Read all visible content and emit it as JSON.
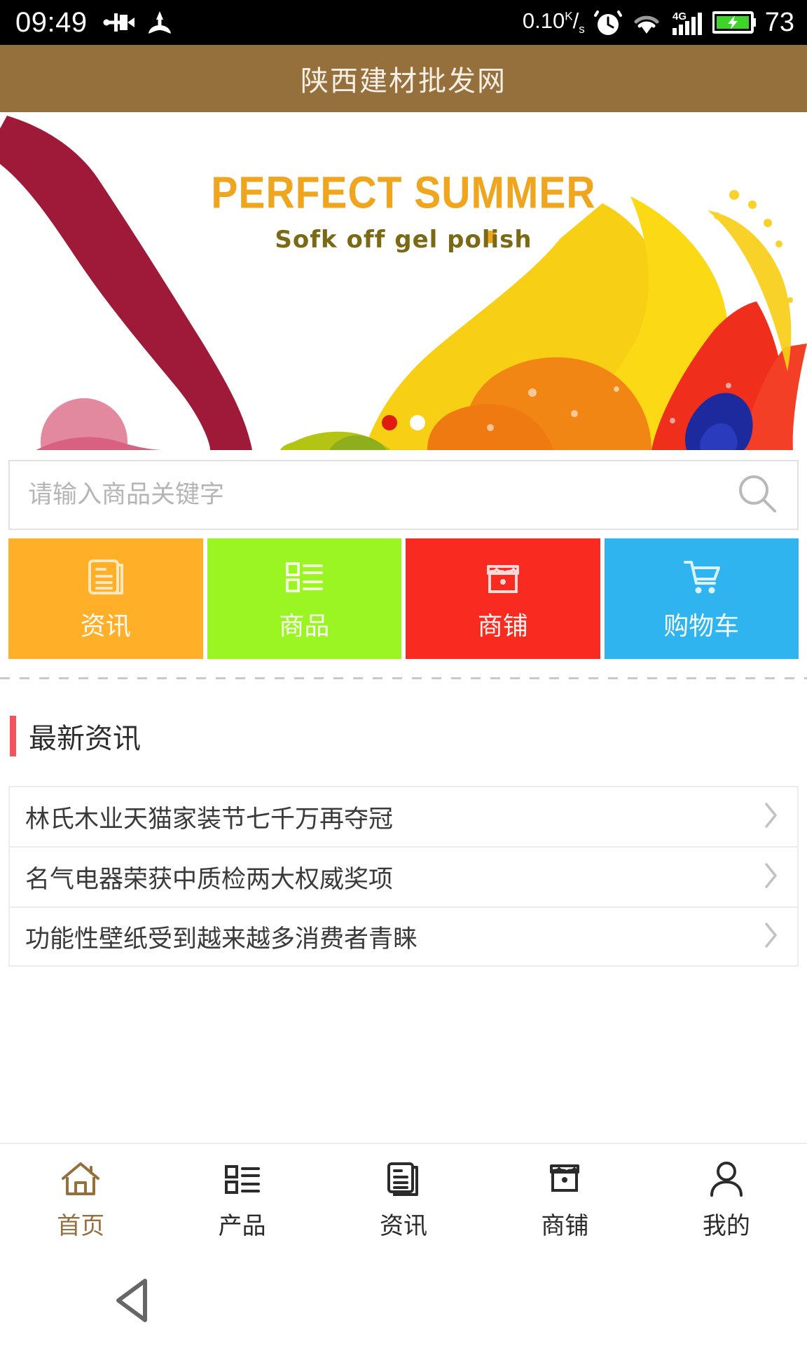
{
  "status_bar": {
    "time": "09:49",
    "network_speed": "0.10",
    "network_speed_unit_top": "K",
    "network_speed_unit_bottom": "s",
    "battery_percent": "73",
    "icons": [
      "usb-icon",
      "share-icon",
      "alarm-icon",
      "wifi-icon",
      "signal-4g-icon",
      "battery-charging-icon"
    ],
    "signal_label": "4G"
  },
  "header": {
    "title": "陕西建材批发网",
    "background_color": "#96703c",
    "title_color": "#f4efe6"
  },
  "banner": {
    "headline": "PERFECT SUMMER",
    "subheadline": "Sofk off gel polish",
    "headline_color": "#efa51d",
    "subheadline_color": "#7a6a16",
    "dots": [
      {
        "state": "active",
        "color": "#e01b12"
      },
      {
        "state": "idle",
        "color": "#ffffff"
      }
    ]
  },
  "search": {
    "placeholder": "请输入商品关键字",
    "value": "",
    "icon": "search-icon"
  },
  "tiles": [
    {
      "label": "资讯",
      "icon": "news-document-icon",
      "color": "#ffaf28"
    },
    {
      "label": "商品",
      "icon": "product-list-icon",
      "color": "#9bf523"
    },
    {
      "label": "商铺",
      "icon": "shop-icon",
      "color": "#f92a20"
    },
    {
      "label": "购物车",
      "icon": "shopping-cart-icon",
      "color": "#30b4ef"
    }
  ],
  "section": {
    "title": "最新资讯",
    "accent_color": "#f2545b"
  },
  "news": [
    {
      "title": "林氏木业天猫家装节七千万再夺冠",
      "chevron": "chevron-right-icon"
    },
    {
      "title": "名气电器荣获中质检两大权威奖项",
      "chevron": "chevron-right-icon"
    },
    {
      "title": "功能性壁纸受到越来越多消费者青睐",
      "chevron": "chevron-right-icon"
    }
  ],
  "bottom_nav": {
    "active_color": "#96703c",
    "items": [
      {
        "label": "首页",
        "icon": "home-icon",
        "active": true
      },
      {
        "label": "产品",
        "icon": "product-list-icon",
        "active": false
      },
      {
        "label": "资讯",
        "icon": "news-document-icon",
        "active": false
      },
      {
        "label": "商铺",
        "icon": "shop-icon",
        "active": false
      },
      {
        "label": "我的",
        "icon": "user-icon",
        "active": false
      }
    ]
  },
  "system_bar": {
    "back": "back-triangle-icon"
  }
}
